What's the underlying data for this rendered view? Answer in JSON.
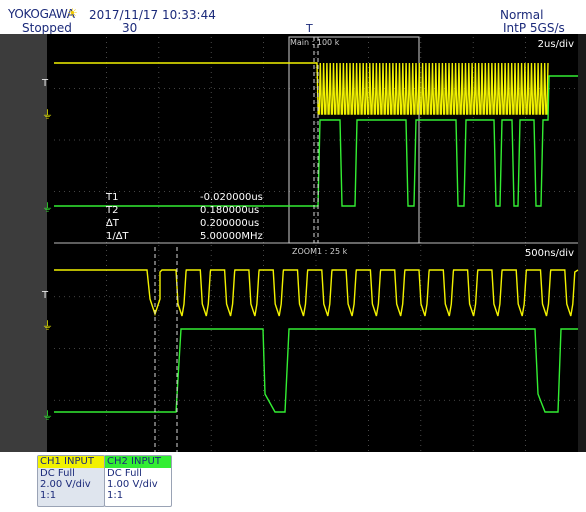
{
  "header": {
    "brand": "YOKOGAWA",
    "datetime": "2017/11/17 10:33:44",
    "status": "Stopped",
    "acq_count": "30",
    "trigger_mode": "Normal",
    "sample_info": "IntP  5GS/s",
    "trigger_marker": "T"
  },
  "main_window": {
    "label": "Main : 100 k",
    "timebase": "2us/div"
  },
  "zoom_window": {
    "label": "ZOOM1 : 25 k",
    "timebase": "500ns/div"
  },
  "cursors": [
    {
      "name": "T1",
      "value": "-0.020000us"
    },
    {
      "name": "T2",
      "value": "0.180000us"
    },
    {
      "name": "∆T",
      "value": "0.200000us"
    },
    {
      "name": "1/∆T",
      "value": "5.00000MHz"
    }
  ],
  "channels": [
    {
      "title": "CH1 INPUT",
      "coupling": "DC Full",
      "scale": "2.00 V/div",
      "probe": "1:1",
      "color": "#f2f200"
    },
    {
      "title": "CH2 INPUT",
      "coupling": "DC Full",
      "scale": "1.00 V/div",
      "probe": "1:1",
      "color": "#33ee33"
    }
  ],
  "colors": {
    "ch1": "#f2f200",
    "ch2": "#33ee33",
    "screen": "#000000",
    "grid": "#555555",
    "text": "#1b2a7a"
  }
}
